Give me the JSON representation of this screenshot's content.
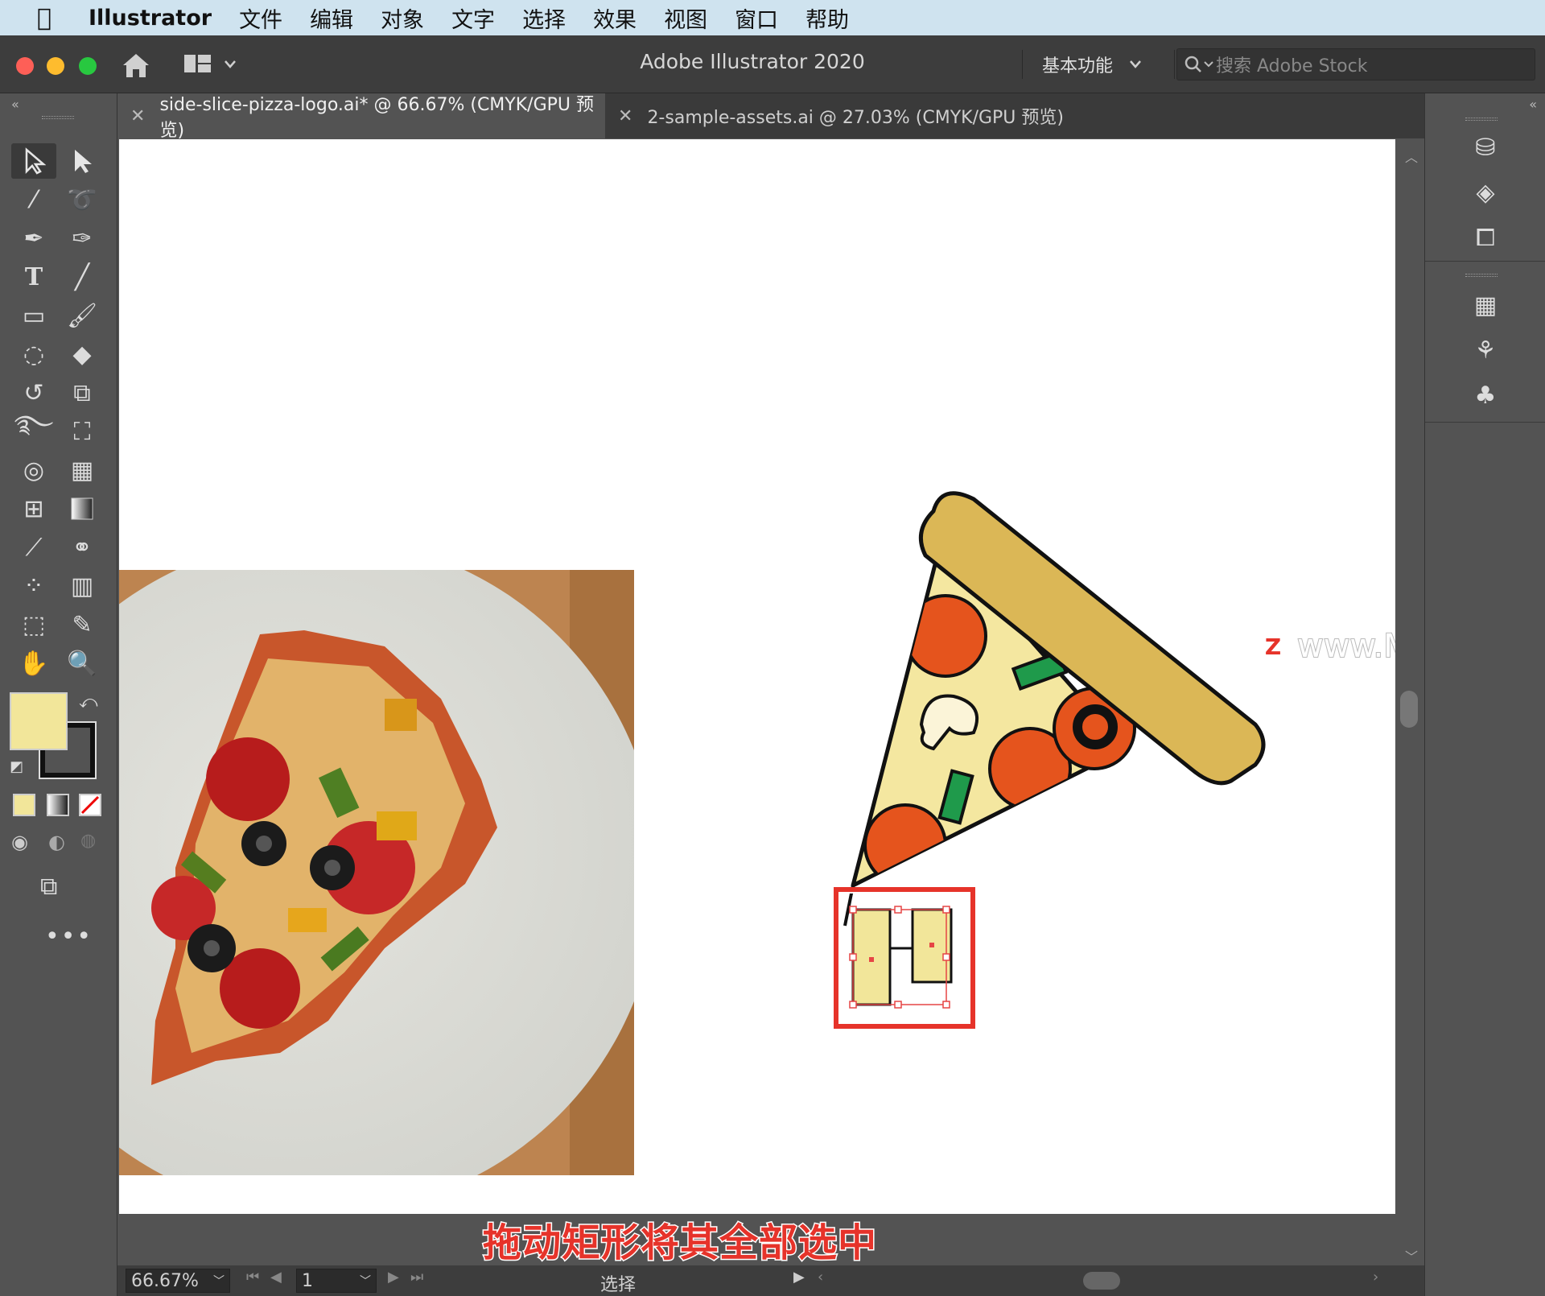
{
  "menubar": {
    "app_name": "Illustrator",
    "items": [
      "文件",
      "编辑",
      "对象",
      "文字",
      "选择",
      "效果",
      "视图",
      "窗口",
      "帮助"
    ]
  },
  "titlebar": {
    "title": "Adobe Illustrator 2020",
    "workspace": "基本功能",
    "search_placeholder": "搜索 Adobe Stock"
  },
  "tabs": [
    {
      "label": "side-slice-pizza-logo.ai* @ 66.67% (CMYK/GPU 预览)",
      "active": true
    },
    {
      "label": "2-sample-assets.ai @ 27.03% (CMYK/GPU 预览)",
      "active": false
    }
  ],
  "colors": {
    "fill": "#f2e69a",
    "pizza_crust": "#dbb756",
    "pizza_cheese": "#f4e7a0",
    "pepperoni": "#e5541d",
    "pepper": "#1f9a4b",
    "highlight": "#e6332a"
  },
  "statusbar": {
    "zoom": "66.67%",
    "artboard": "1",
    "tool": "选择"
  },
  "caption": "拖动矩形将其全部选中",
  "watermark": "www.MacZ.com"
}
